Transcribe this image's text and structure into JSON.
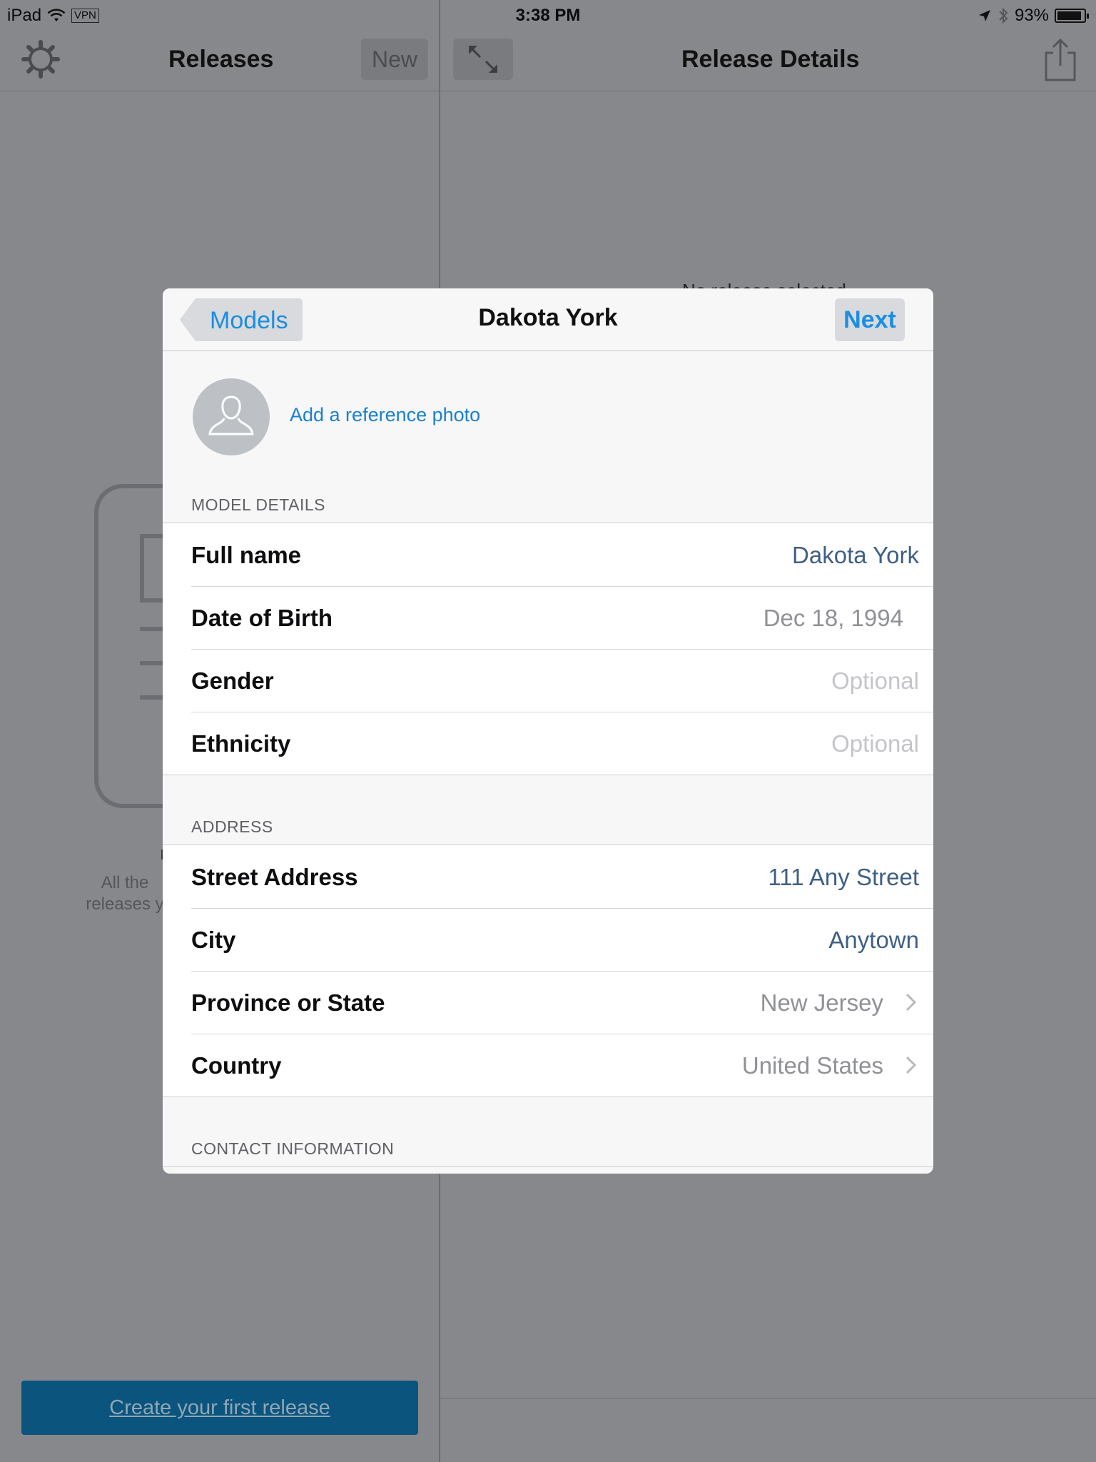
{
  "status_bar": {
    "device": "iPad",
    "vpn": "VPN",
    "time": "3:38 PM",
    "battery": "93%",
    "battery_level": 0.93
  },
  "left_pane": {
    "title": "Releases",
    "new_label": "New",
    "hint_text": "All the\nreleases y",
    "create_button": "Create your first release"
  },
  "right_pane": {
    "title": "Release Details",
    "empty_text": "No release selected"
  },
  "modal": {
    "back_label": "Models",
    "title": "Dakota York",
    "next_label": "Next",
    "add_photo": "Add a reference photo",
    "sections": {
      "model_details": "MODEL DETAILS",
      "address": "ADDRESS",
      "contact": "CONTACT INFORMATION"
    },
    "model_rows": [
      {
        "label": "Full name",
        "value": "Dakota York"
      },
      {
        "label": "Date of Birth",
        "value": "Dec 18, 1994"
      },
      {
        "label": "Gender",
        "value": "Optional"
      },
      {
        "label": "Ethnicity",
        "value": "Optional"
      }
    ],
    "address_rows": [
      {
        "label": "Street Address",
        "value": "111 Any Street"
      },
      {
        "label": "City",
        "value": "Anytown"
      },
      {
        "label": "Province or State",
        "value": "New Jersey"
      },
      {
        "label": "Country",
        "value": "United States"
      }
    ]
  },
  "colors": {
    "accent": "#1a8ee2",
    "entered_value": "#3f5f84",
    "dim_background": "#87888c",
    "create_button": "#0b547d"
  },
  "icons": [
    "wifi-icon",
    "location-arrow-icon",
    "bluetooth-icon",
    "battery-icon",
    "gear-icon",
    "expand-icon",
    "share-icon",
    "person-icon",
    "chevron-right-icon",
    "back-arrow-icon"
  ]
}
